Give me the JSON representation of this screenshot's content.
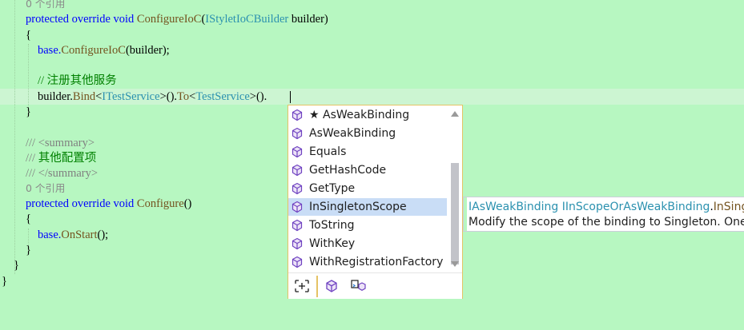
{
  "code": {
    "codelens_top": "0 个引用",
    "line1": {
      "kw": "protected override void ",
      "method": "ConfigureIoC",
      "open": "(",
      "param_type": "IStyletIoCBuilder",
      "rest": " builder)"
    },
    "brace_open_1": "{",
    "line3": {
      "base": "base.",
      "method": "ConfigureIoC",
      "rest": "(builder);"
    },
    "comment": "// 注册其他服务",
    "line5": {
      "a": "builder.",
      "bind": "Bind",
      "lt1": "<",
      "t1": "ITestService",
      "mid": ">().",
      "to": "To",
      "lt2": "<",
      "t2": "TestService",
      "end": ">()."
    },
    "brace_close_1": "}",
    "xml1": {
      "slashes": "/// ",
      "tag": "<summary>"
    },
    "xml2": {
      "slashes": "/// ",
      "text": "其他配置项"
    },
    "xml3": {
      "slashes": "/// ",
      "tag": "</summary>"
    },
    "codelens_2": "0 个引用",
    "line10": {
      "kw": "protected override void ",
      "method": "Configure",
      "rest": "()"
    },
    "brace_open_2": "{",
    "line12": {
      "base": "base.",
      "method": "OnStart",
      "rest": "();"
    },
    "brace_close_2": "}",
    "brace_class": "}",
    "brace_ns": "}"
  },
  "completion": {
    "items": [
      {
        "label": "★ AsWeakBinding",
        "icon": "method-cube-icon",
        "selected": false
      },
      {
        "label": "AsWeakBinding",
        "icon": "method-cube-icon",
        "selected": false
      },
      {
        "label": "Equals",
        "icon": "method-cube-icon",
        "selected": false
      },
      {
        "label": "GetHashCode",
        "icon": "method-cube-icon",
        "selected": false
      },
      {
        "label": "GetType",
        "icon": "method-cube-icon",
        "selected": false
      },
      {
        "label": "InSingletonScope",
        "icon": "method-cube-icon",
        "selected": true
      },
      {
        "label": "ToString",
        "icon": "method-cube-icon",
        "selected": false
      },
      {
        "label": "WithKey",
        "icon": "method-cube-icon",
        "selected": false
      },
      {
        "label": "WithRegistrationFactory",
        "icon": "method-cube-icon",
        "selected": false
      }
    ],
    "filters": [
      "expand-target-icon",
      "method-filter-icon",
      "extension-method-filter-icon"
    ]
  },
  "tooltip": {
    "return_type": "IAsWeakBinding",
    "owner_type": "IInScopeOrAsWeakBinding",
    "dot": ".",
    "member": "InSing",
    "description": "Modify the scope of the binding to Singleton. One"
  },
  "colors": {
    "background": "#b7f7c1",
    "keyword": "#0000ff",
    "type": "#2b91af",
    "method": "#74531f",
    "comment": "#008000",
    "selection": "#c9ddf6",
    "popup_border": "#e5c365",
    "icon": "#6f42c1"
  }
}
